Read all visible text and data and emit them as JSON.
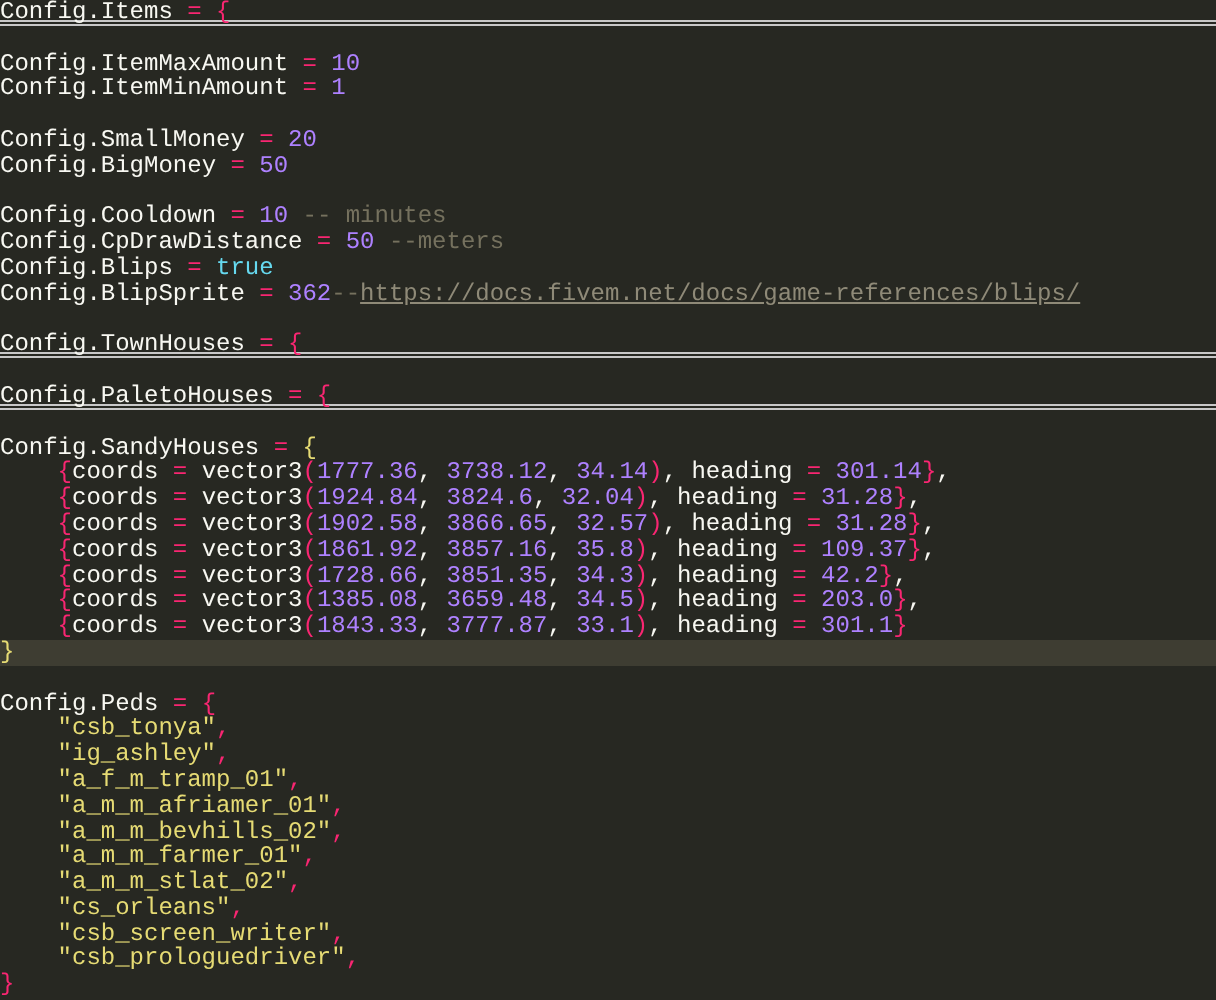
{
  "lines": [
    {
      "folded": true,
      "current": false,
      "indent": false,
      "tokens": [
        {
          "kind": "ident",
          "text": "Config.Items"
        },
        {
          "kind": "op",
          "text": " = {"
        }
      ]
    },
    {
      "gap_before": true,
      "folded": false,
      "current": false,
      "indent": false,
      "tokens": [
        {
          "kind": "ident",
          "text": "Config.ItemMaxAmount"
        },
        {
          "kind": "op",
          "text": " = "
        },
        {
          "kind": "num",
          "text": "10"
        }
      ]
    },
    {
      "folded": false,
      "current": false,
      "indent": false,
      "tokens": [
        {
          "kind": "ident",
          "text": "Config.ItemMinAmount"
        },
        {
          "kind": "op",
          "text": " = "
        },
        {
          "kind": "num",
          "text": "1"
        }
      ]
    },
    {
      "gap_before": true,
      "folded": false,
      "current": false,
      "indent": false,
      "tokens": [
        {
          "kind": "ident",
          "text": "Config.SmallMoney"
        },
        {
          "kind": "op",
          "text": " = "
        },
        {
          "kind": "num",
          "text": "20"
        }
      ]
    },
    {
      "folded": false,
      "current": false,
      "indent": false,
      "tokens": [
        {
          "kind": "ident",
          "text": "Config.BigMoney"
        },
        {
          "kind": "op",
          "text": " = "
        },
        {
          "kind": "num",
          "text": "50"
        }
      ]
    },
    {
      "gap_before": true,
      "folded": false,
      "current": false,
      "indent": false,
      "tokens": [
        {
          "kind": "ident",
          "text": "Config.Cooldown"
        },
        {
          "kind": "op",
          "text": " = "
        },
        {
          "kind": "num",
          "text": "10"
        },
        {
          "kind": "comment",
          "text": " -- minutes"
        }
      ]
    },
    {
      "folded": false,
      "current": false,
      "indent": false,
      "tokens": [
        {
          "kind": "ident",
          "text": "Config.CpDrawDistance"
        },
        {
          "kind": "op",
          "text": " = "
        },
        {
          "kind": "num",
          "text": "50"
        },
        {
          "kind": "comment",
          "text": " --meters"
        }
      ]
    },
    {
      "folded": false,
      "current": false,
      "indent": false,
      "tokens": [
        {
          "kind": "ident",
          "text": "Config.Blips"
        },
        {
          "kind": "op",
          "text": " = "
        },
        {
          "kind": "bool",
          "text": "true"
        }
      ]
    },
    {
      "folded": false,
      "current": false,
      "indent": false,
      "tokens": [
        {
          "kind": "ident",
          "text": "Config.BlipSprite"
        },
        {
          "kind": "op",
          "text": " = "
        },
        {
          "kind": "num",
          "text": "362"
        },
        {
          "kind": "comment",
          "text": "--"
        },
        {
          "kind": "link",
          "text": "https://docs.fivem.net/docs/game-references/blips/"
        }
      ]
    },
    {
      "gap_before": true,
      "folded": true,
      "current": false,
      "indent": false,
      "tokens": [
        {
          "kind": "ident",
          "text": "Config.TownHouses"
        },
        {
          "kind": "op",
          "text": " = {"
        }
      ]
    },
    {
      "gap_before": true,
      "folded": true,
      "current": false,
      "indent": false,
      "tokens": [
        {
          "kind": "ident",
          "text": "Config.PaletoHouses"
        },
        {
          "kind": "op",
          "text": " = {"
        }
      ]
    },
    {
      "gap_before": true,
      "folded": false,
      "current": false,
      "indent": false,
      "tokens": [
        {
          "kind": "ident",
          "text": "Config.SandyHouses"
        },
        {
          "kind": "op",
          "text": " = "
        },
        {
          "kind": "brace",
          "text": "{"
        }
      ]
    },
    {
      "folded": false,
      "current": false,
      "indent": true,
      "tokens": [
        {
          "kind": "op",
          "text": "{"
        },
        {
          "kind": "ident",
          "text": "coords"
        },
        {
          "kind": "op",
          "text": " = "
        },
        {
          "kind": "ident",
          "text": "vector3"
        },
        {
          "kind": "op",
          "text": "("
        },
        {
          "kind": "num",
          "text": "1777.36"
        },
        {
          "kind": "ident",
          "text": ", "
        },
        {
          "kind": "num",
          "text": "3738.12"
        },
        {
          "kind": "ident",
          "text": ", "
        },
        {
          "kind": "num",
          "text": "34.14"
        },
        {
          "kind": "op",
          "text": ")"
        },
        {
          "kind": "ident",
          "text": ", heading"
        },
        {
          "kind": "op",
          "text": " = "
        },
        {
          "kind": "num",
          "text": "301.14"
        },
        {
          "kind": "op",
          "text": "}"
        },
        {
          "kind": "ident",
          "text": ","
        }
      ]
    },
    {
      "folded": false,
      "current": false,
      "indent": true,
      "tokens": [
        {
          "kind": "op",
          "text": "{"
        },
        {
          "kind": "ident",
          "text": "coords"
        },
        {
          "kind": "op",
          "text": " = "
        },
        {
          "kind": "ident",
          "text": "vector3"
        },
        {
          "kind": "op",
          "text": "("
        },
        {
          "kind": "num",
          "text": "1924.84"
        },
        {
          "kind": "ident",
          "text": ", "
        },
        {
          "kind": "num",
          "text": "3824.6"
        },
        {
          "kind": "ident",
          "text": ", "
        },
        {
          "kind": "num",
          "text": "32.04"
        },
        {
          "kind": "op",
          "text": ")"
        },
        {
          "kind": "ident",
          "text": ", heading"
        },
        {
          "kind": "op",
          "text": " = "
        },
        {
          "kind": "num",
          "text": "31.28"
        },
        {
          "kind": "op",
          "text": "}"
        },
        {
          "kind": "ident",
          "text": ","
        }
      ]
    },
    {
      "folded": false,
      "current": false,
      "indent": true,
      "tokens": [
        {
          "kind": "op",
          "text": "{"
        },
        {
          "kind": "ident",
          "text": "coords"
        },
        {
          "kind": "op",
          "text": " = "
        },
        {
          "kind": "ident",
          "text": "vector3"
        },
        {
          "kind": "op",
          "text": "("
        },
        {
          "kind": "num",
          "text": "1902.58"
        },
        {
          "kind": "ident",
          "text": ", "
        },
        {
          "kind": "num",
          "text": "3866.65"
        },
        {
          "kind": "ident",
          "text": ", "
        },
        {
          "kind": "num",
          "text": "32.57"
        },
        {
          "kind": "op",
          "text": ")"
        },
        {
          "kind": "ident",
          "text": ", heading"
        },
        {
          "kind": "op",
          "text": " = "
        },
        {
          "kind": "num",
          "text": "31.28"
        },
        {
          "kind": "op",
          "text": "}"
        },
        {
          "kind": "ident",
          "text": ","
        }
      ]
    },
    {
      "folded": false,
      "current": false,
      "indent": true,
      "tokens": [
        {
          "kind": "op",
          "text": "{"
        },
        {
          "kind": "ident",
          "text": "coords"
        },
        {
          "kind": "op",
          "text": " = "
        },
        {
          "kind": "ident",
          "text": "vector3"
        },
        {
          "kind": "op",
          "text": "("
        },
        {
          "kind": "num",
          "text": "1861.92"
        },
        {
          "kind": "ident",
          "text": ", "
        },
        {
          "kind": "num",
          "text": "3857.16"
        },
        {
          "kind": "ident",
          "text": ", "
        },
        {
          "kind": "num",
          "text": "35.8"
        },
        {
          "kind": "op",
          "text": ")"
        },
        {
          "kind": "ident",
          "text": ", heading"
        },
        {
          "kind": "op",
          "text": " = "
        },
        {
          "kind": "num",
          "text": "109.37"
        },
        {
          "kind": "op",
          "text": "}"
        },
        {
          "kind": "ident",
          "text": ","
        }
      ]
    },
    {
      "folded": false,
      "current": false,
      "indent": true,
      "tokens": [
        {
          "kind": "op",
          "text": "{"
        },
        {
          "kind": "ident",
          "text": "coords"
        },
        {
          "kind": "op",
          "text": " = "
        },
        {
          "kind": "ident",
          "text": "vector3"
        },
        {
          "kind": "op",
          "text": "("
        },
        {
          "kind": "num",
          "text": "1728.66"
        },
        {
          "kind": "ident",
          "text": ", "
        },
        {
          "kind": "num",
          "text": "3851.35"
        },
        {
          "kind": "ident",
          "text": ", "
        },
        {
          "kind": "num",
          "text": "34.3"
        },
        {
          "kind": "op",
          "text": ")"
        },
        {
          "kind": "ident",
          "text": ", heading"
        },
        {
          "kind": "op",
          "text": " = "
        },
        {
          "kind": "num",
          "text": "42.2"
        },
        {
          "kind": "op",
          "text": "}"
        },
        {
          "kind": "ident",
          "text": ","
        }
      ]
    },
    {
      "folded": false,
      "current": false,
      "indent": true,
      "tokens": [
        {
          "kind": "op",
          "text": "{"
        },
        {
          "kind": "ident",
          "text": "coords"
        },
        {
          "kind": "op",
          "text": " = "
        },
        {
          "kind": "ident",
          "text": "vector3"
        },
        {
          "kind": "op",
          "text": "("
        },
        {
          "kind": "num",
          "text": "1385.08"
        },
        {
          "kind": "ident",
          "text": ", "
        },
        {
          "kind": "num",
          "text": "3659.48"
        },
        {
          "kind": "ident",
          "text": ", "
        },
        {
          "kind": "num",
          "text": "34.5"
        },
        {
          "kind": "op",
          "text": ")"
        },
        {
          "kind": "ident",
          "text": ", heading"
        },
        {
          "kind": "op",
          "text": " = "
        },
        {
          "kind": "num",
          "text": "203.0"
        },
        {
          "kind": "op",
          "text": "}"
        },
        {
          "kind": "ident",
          "text": ","
        }
      ]
    },
    {
      "folded": false,
      "current": false,
      "indent": true,
      "tokens": [
        {
          "kind": "op",
          "text": "{"
        },
        {
          "kind": "ident",
          "text": "coords"
        },
        {
          "kind": "op",
          "text": " = "
        },
        {
          "kind": "ident",
          "text": "vector3"
        },
        {
          "kind": "op",
          "text": "("
        },
        {
          "kind": "num",
          "text": "1843.33"
        },
        {
          "kind": "ident",
          "text": ", "
        },
        {
          "kind": "num",
          "text": "3777.87"
        },
        {
          "kind": "ident",
          "text": ", "
        },
        {
          "kind": "num",
          "text": "33.1"
        },
        {
          "kind": "op",
          "text": ")"
        },
        {
          "kind": "ident",
          "text": ", heading"
        },
        {
          "kind": "op",
          "text": " = "
        },
        {
          "kind": "num",
          "text": "301.1"
        },
        {
          "kind": "op",
          "text": "}"
        }
      ]
    },
    {
      "folded": false,
      "current": true,
      "indent": false,
      "tokens": [
        {
          "kind": "brace",
          "text": "}"
        }
      ]
    },
    {
      "gap_before": true,
      "folded": false,
      "current": false,
      "indent": false,
      "tokens": [
        {
          "kind": "ident",
          "text": "Config.Peds"
        },
        {
          "kind": "op",
          "text": " = {"
        }
      ]
    },
    {
      "folded": false,
      "current": false,
      "indent": true,
      "tokens": [
        {
          "kind": "str",
          "text": "\"csb_tonya\""
        },
        {
          "kind": "op",
          "text": ","
        }
      ]
    },
    {
      "folded": false,
      "current": false,
      "indent": true,
      "tokens": [
        {
          "kind": "str",
          "text": "\"ig_ashley\""
        },
        {
          "kind": "op",
          "text": ","
        }
      ]
    },
    {
      "folded": false,
      "current": false,
      "indent": true,
      "tokens": [
        {
          "kind": "str",
          "text": "\"a_f_m_tramp_01\""
        },
        {
          "kind": "op",
          "text": ","
        }
      ]
    },
    {
      "folded": false,
      "current": false,
      "indent": true,
      "tokens": [
        {
          "kind": "str",
          "text": "\"a_m_m_afriamer_01\""
        },
        {
          "kind": "op",
          "text": ","
        }
      ]
    },
    {
      "folded": false,
      "current": false,
      "indent": true,
      "tokens": [
        {
          "kind": "str",
          "text": "\"a_m_m_bevhills_02\""
        },
        {
          "kind": "op",
          "text": ","
        }
      ]
    },
    {
      "folded": false,
      "current": false,
      "indent": true,
      "tokens": [
        {
          "kind": "str",
          "text": "\"a_m_m_farmer_01\""
        },
        {
          "kind": "op",
          "text": ","
        }
      ]
    },
    {
      "folded": false,
      "current": false,
      "indent": true,
      "tokens": [
        {
          "kind": "str",
          "text": "\"a_m_m_stlat_02\""
        },
        {
          "kind": "op",
          "text": ","
        }
      ]
    },
    {
      "folded": false,
      "current": false,
      "indent": true,
      "tokens": [
        {
          "kind": "str",
          "text": "\"cs_orleans\""
        },
        {
          "kind": "op",
          "text": ","
        }
      ]
    },
    {
      "folded": false,
      "current": false,
      "indent": true,
      "tokens": [
        {
          "kind": "str",
          "text": "\"csb_screen_writer\""
        },
        {
          "kind": "op",
          "text": ","
        }
      ]
    },
    {
      "folded": false,
      "current": false,
      "indent": true,
      "tokens": [
        {
          "kind": "str",
          "text": "\"csb_prologuedriver\""
        },
        {
          "kind": "op",
          "text": ","
        }
      ]
    },
    {
      "folded": false,
      "current": false,
      "indent": false,
      "tokens": [
        {
          "kind": "op",
          "text": "}"
        }
      ]
    }
  ]
}
